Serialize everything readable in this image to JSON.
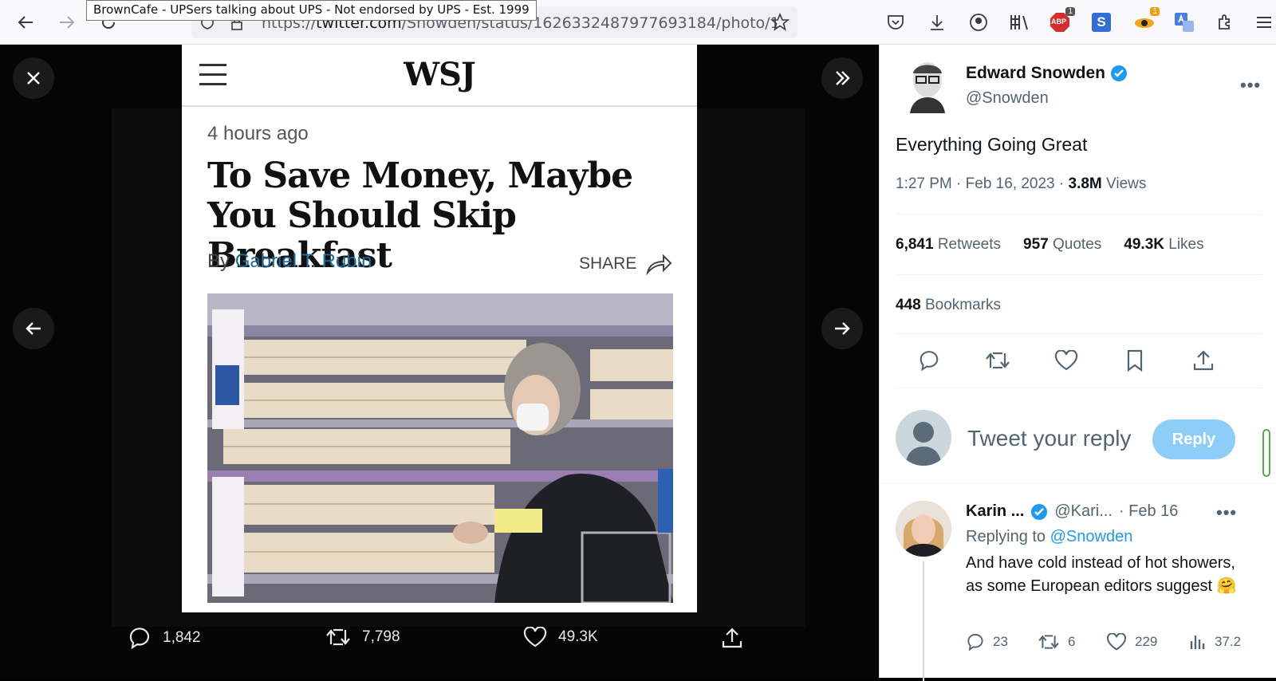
{
  "browser": {
    "url_prefix": "https://",
    "url_domain": "twitter.com",
    "url_path": "/Snowden/status/1626332487977693184/photo/1",
    "tooltip": "BrownCafe - UPSers talking about UPS - Not endorsed by UPS - Est. 1999",
    "ext_badge_1": "1",
    "ext_badge_2": "1",
    "ext_abp": "ABP",
    "ext_s": "S"
  },
  "article": {
    "logo": "WSJ",
    "time_ago": "4 hours ago",
    "headline": "To Save Money, Maybe You Should Skip Breakfast",
    "by": "By",
    "author": "Gabriel T. Rubin",
    "share": "SHARE"
  },
  "media_actions": {
    "replies": "1,842",
    "retweets": "7,798",
    "likes": "49.3K"
  },
  "tweet": {
    "name": "Edward Snowden",
    "handle": "@Snowden",
    "text": "Everything Going Great",
    "time": "1:27 PM · Feb 16, 2023 · ",
    "views_count": "3.8M",
    "views_label": " Views",
    "retweets_count": "6,841",
    "retweets_label": " Retweets",
    "quotes_count": "957",
    "quotes_label": " Quotes",
    "likes_count": "49.3K",
    "likes_label": " Likes",
    "bookmarks_count": "448",
    "bookmarks_label": " Bookmarks"
  },
  "compose": {
    "placeholder": "Tweet your reply",
    "reply_button": "Reply"
  },
  "reply": {
    "name": "Karin ...",
    "handle": "@Kari...",
    "date": "· Feb 16",
    "replying_prefix": "Replying to ",
    "replying_to": "@Snowden",
    "text": "And have cold instead of hot showers, as some European editors suggest 🤗",
    "replies": "23",
    "retweets": "6",
    "likes": "229",
    "views": "37.2"
  },
  "colors": {
    "accent": "#1d9bf0",
    "reply_button": "#8ecdf8",
    "verified": "#1d9bf0"
  }
}
